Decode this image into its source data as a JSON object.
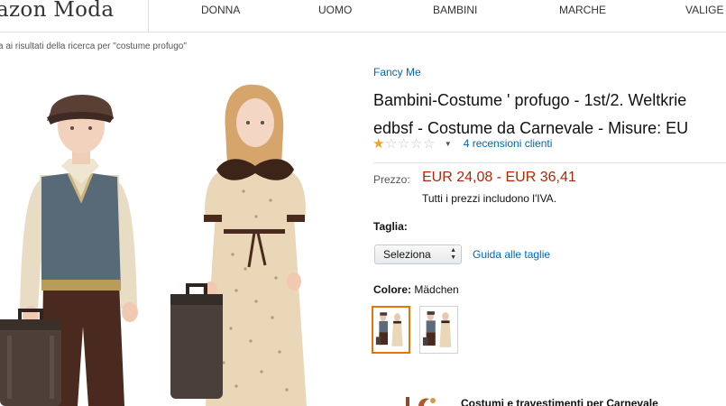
{
  "header": {
    "logo_text": "azon Moda",
    "nav": [
      "DONNA",
      "UOMO",
      "BAMBINI",
      "MARCHE",
      "VALIGE"
    ]
  },
  "breadcrumb": "a ai risultati della ricerca per \"costume profugo\"",
  "product": {
    "brand": "Fancy Me",
    "title_lines": [
      "Bambini-Costume ' profugo - 1st/2. Weltkrie",
      "edbsf - Costume da Carnevale - Misure: EU"
    ],
    "rating": 1,
    "rating_max": 5,
    "reviews_text": "4 recensioni clienti",
    "price_label": "Prezzo:",
    "price_value": "EUR 24,08 - EUR 36,41",
    "vat_note": "Tutti i prezzi includono l'IVA.",
    "size_label": "Taglia:",
    "size_selected": "Seleziona",
    "size_guide": "Guida alle taglie",
    "color_label": "Colore:",
    "color_value": "Mädchen",
    "bottom_link": "Costumi e travestimenti per Carnevale"
  },
  "colors": {
    "link": "#0066c0",
    "price": "#b12704",
    "star_on": "#f0a12b",
    "swatch_selected": "#e77600"
  },
  "icons": [
    "star-icon",
    "chevron-down-icon",
    "select-arrows-icon",
    "costume-category-icon"
  ]
}
